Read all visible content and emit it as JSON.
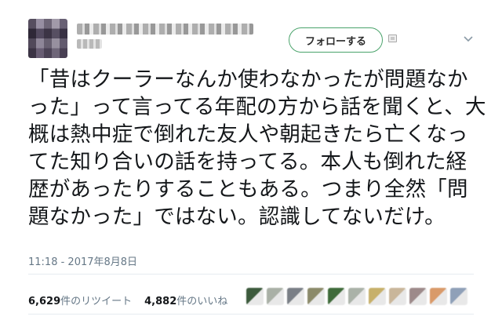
{
  "header": {
    "follow_label": "フォローする"
  },
  "tweet": {
    "text": "「昔はクーラーなんか使わなかったが問題なかった」って言ってる年配の方から話を聞くと、大概は熱中症で倒れた友人や朝起きたら亡くなってた知り合いの話を持ってる。本人も倒れた経歴があったりすることもある。つまり全然「問題なかった」ではない。認識してないだけ。",
    "timestamp": "11:18 - 2017年8月8日"
  },
  "stats": {
    "retweets_count": "6,629",
    "retweets_label": "件のリツイート",
    "likes_count": "4,882",
    "likes_label": "件のいいね"
  },
  "likers": {
    "colors": [
      "#3c5a3c",
      "#a9b0a6",
      "#7a7f86",
      "#8b8a6a",
      "#3f6b3a",
      "#aab2a8",
      "#c7b06a",
      "#c9b69a",
      "#9d8a8a",
      "#d99a6a",
      "#8fa0b8"
    ]
  },
  "colors": {
    "follow_border": "#4aa36b",
    "text": "#14171a",
    "meta": "#657786"
  },
  "icons": {
    "dropdown": "chevron-down-icon",
    "badge": "image-badge-icon"
  }
}
